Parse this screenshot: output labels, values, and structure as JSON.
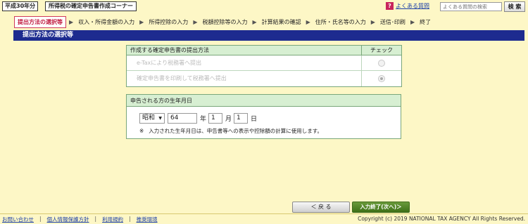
{
  "header": {
    "year_label": "平成30年分",
    "corner_title": "所得税の確定申告書作成コーナー",
    "faq_icon": "?",
    "faq_link": "よくある質問",
    "search_placeholder": "よくある質問の検索",
    "search_button": "検 索"
  },
  "steps": [
    {
      "label": "提出方法の選択等",
      "active": true
    },
    {
      "label": "収入・所得金額の入力",
      "active": false
    },
    {
      "label": "所得控除の入力",
      "active": false
    },
    {
      "label": "税額控除等の入力",
      "active": false
    },
    {
      "label": "計算結果の確認",
      "active": false
    },
    {
      "label": "住所・氏名等の入力",
      "active": false
    },
    {
      "label": "送信･印刷",
      "active": false
    },
    {
      "label": "終了",
      "active": false
    }
  ],
  "step_arrow": "▶",
  "section_title": "提出方法の選択等",
  "method_table": {
    "header_label": "作成する確定申告書の提出方法",
    "header_check": "チェック",
    "rows": [
      {
        "label": "e-Taxにより税務署へ提出",
        "checked": false
      },
      {
        "label": "確定申告書を印刷して税務署へ提出",
        "checked": true
      }
    ]
  },
  "birth_table": {
    "header_label": "申告される方の生年月日",
    "era_value": "昭和",
    "era_arrow": "▼",
    "year_value": "64",
    "year_unit": "年",
    "month_value": "1",
    "month_unit": "月",
    "day_value": "1",
    "day_unit": "日",
    "note_mark": "※",
    "note_text": "入力された生年月日は、申告書等への表示や控除額の計算に使用します。"
  },
  "buttons": {
    "back": "＜ 戻 る",
    "next": "入力終了(次へ)＞"
  },
  "footer": {
    "links": [
      "お問い合わせ",
      "個人情報保護方針",
      "利用規約",
      "推奨環境"
    ],
    "copyright": "Copyright (c) 2019 NATIONAL TAX AGENCY All Rights Reserved."
  }
}
